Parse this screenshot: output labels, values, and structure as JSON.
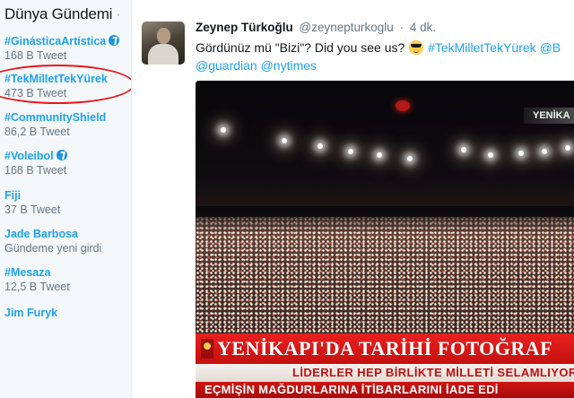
{
  "trends": {
    "title": "Dünya Gündemi",
    "title_dot": "·",
    "items": [
      {
        "name": "#GinásticaArtística",
        "count": "168 B Tweet",
        "badge": true
      },
      {
        "name": "#TekMilletTekYürek",
        "count": "473 B Tweet",
        "badge": false,
        "highlighted": true
      },
      {
        "name": "#CommunityShield",
        "count": "86,2 B Tweet",
        "badge": false
      },
      {
        "name": "#Voleibol",
        "count": "168 B Tweet",
        "badge": true
      },
      {
        "name": "Fiji",
        "count": "37 B Tweet",
        "badge": false
      },
      {
        "name": "Jade Barbosa",
        "count": "Gündeme yeni girdi",
        "badge": false
      },
      {
        "name": "#Mesaza",
        "count": "12,5 B Tweet",
        "badge": false
      },
      {
        "name": "Jim Furyk",
        "count": "",
        "badge": false
      }
    ]
  },
  "tweet": {
    "author_name": "Zeynep Türkoğlu",
    "author_handle": "@zeynepturkoglu",
    "separator": "·",
    "time": "4 dk.",
    "text_line1_prefix": "Gördünüz mü \"Bizi\"? Did you see us?",
    "emoji": "smiling-face-with-sunglasses",
    "hashtag1": "#TekMilletTekYürek",
    "hashtag2_partial": "@B",
    "mention1": "@guardian",
    "mention2": "@nytimes",
    "media": {
      "channel_bug": "YENİKA",
      "headline": "YENİKAPI'DA TARİHİ FOTOĞRAF",
      "subline": "LİDERLER HEP BİRLİKTE MİLLETİ SELAMLIYOR",
      "ticker": "EÇMİŞİN MAĞDURLARINA İTİBARLARINI İADE EDİ"
    }
  },
  "colors": {
    "link": "#1da1f2",
    "muted": "#657786",
    "highlight_ring": "#e8161b",
    "panel_bg": "#f5f8fa"
  }
}
